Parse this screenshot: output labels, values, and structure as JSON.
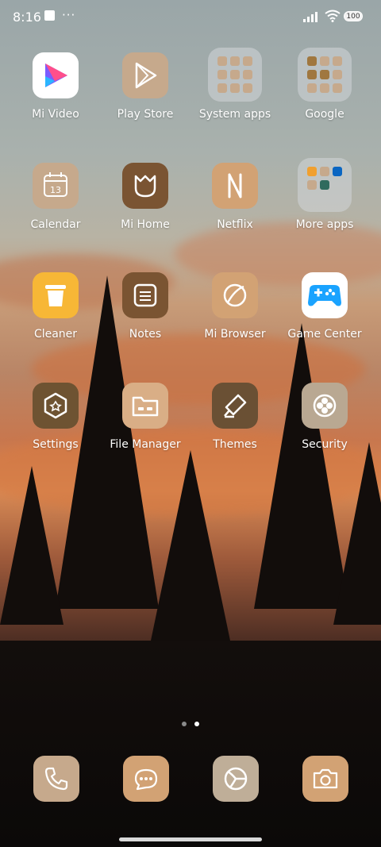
{
  "status_bar": {
    "time": "8:16",
    "more": "···",
    "battery": "100"
  },
  "apps": [
    {
      "label": "Mi Video",
      "icon": "mi-video-icon"
    },
    {
      "label": "Play Store",
      "icon": "play-store-icon"
    },
    {
      "label": "System apps",
      "icon": "system-apps-folder-icon"
    },
    {
      "label": "Google",
      "icon": "google-folder-icon"
    },
    {
      "label": "Calendar",
      "icon": "calendar-icon",
      "badge": "13"
    },
    {
      "label": "Mi Home",
      "icon": "mi-home-icon"
    },
    {
      "label": "Netflix",
      "icon": "netflix-icon"
    },
    {
      "label": "More apps",
      "icon": "more-apps-folder-icon"
    },
    {
      "label": "Cleaner",
      "icon": "cleaner-icon"
    },
    {
      "label": "Notes",
      "icon": "notes-icon"
    },
    {
      "label": "Mi Browser",
      "icon": "browser-icon"
    },
    {
      "label": "Game Center",
      "icon": "game-center-icon"
    },
    {
      "label": "Settings",
      "icon": "settings-icon"
    },
    {
      "label": "File Manager",
      "icon": "file-manager-icon"
    },
    {
      "label": "Themes",
      "icon": "themes-icon"
    },
    {
      "label": "Security",
      "icon": "security-icon"
    }
  ],
  "dock": [
    {
      "icon": "phone-icon"
    },
    {
      "icon": "messages-icon"
    },
    {
      "icon": "google-chrome-icon"
    },
    {
      "icon": "camera-icon"
    }
  ],
  "pager": {
    "pages": 2,
    "active": 2
  },
  "colors": {
    "tan": "#c6a98c",
    "brown": "#7a5432",
    "orange": "#d2a274",
    "accent_blue": "#1aa3ff"
  }
}
